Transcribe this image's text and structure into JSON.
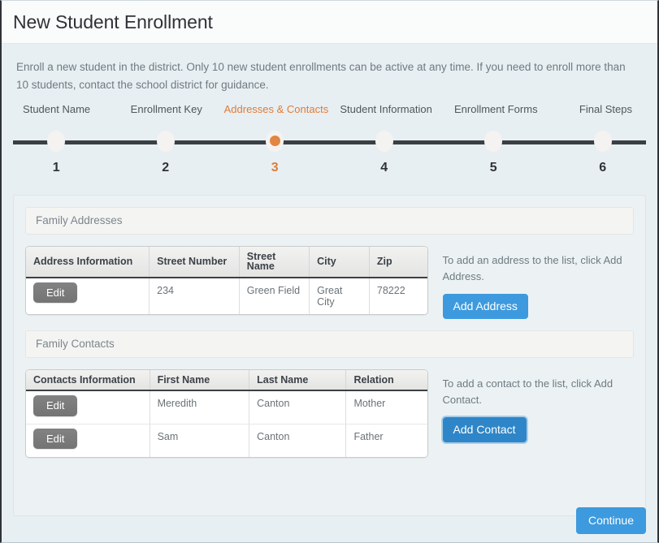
{
  "header": {
    "title": "New Student Enrollment"
  },
  "intro": {
    "text": "Enroll a new student in the district. Only 10 new student enrollments can be active at any time. If you need to enroll more than 10 students, contact the school district for guidance."
  },
  "stepper": {
    "active_step": 3,
    "active_color": "#e07b39",
    "steps": [
      {
        "number": "1",
        "label": "Student Name"
      },
      {
        "number": "2",
        "label": "Enrollment Key"
      },
      {
        "number": "3",
        "label": "Addresses & Contacts"
      },
      {
        "number": "4",
        "label": "Student Information"
      },
      {
        "number": "5",
        "label": "Enrollment Forms"
      },
      {
        "number": "6",
        "label": "Final Steps"
      }
    ]
  },
  "addresses": {
    "section_title": "Family Addresses",
    "columns": [
      "Address Information",
      "Street Number",
      "Street Name",
      "City",
      "Zip"
    ],
    "rows": [
      {
        "edit_label": "Edit",
        "street_number": "234",
        "street_name": "Green Field",
        "city": "Great City",
        "zip": "78222"
      }
    ],
    "helper_text": "To add an address to the list, click Add Address.",
    "add_button_label": "Add Address"
  },
  "contacts": {
    "section_title": "Family Contacts",
    "columns": [
      "Contacts Information",
      "First Name",
      "Last Name",
      "Relation"
    ],
    "rows": [
      {
        "edit_label": "Edit",
        "first_name": "Meredith",
        "last_name": "Canton",
        "relation": "Mother"
      },
      {
        "edit_label": "Edit",
        "first_name": "Sam",
        "last_name": "Canton",
        "relation": "Father"
      }
    ],
    "helper_text": "To add a contact to the list, click Add Contact.",
    "add_button_label": "Add Contact"
  },
  "footer": {
    "continue_label": "Continue"
  },
  "colors": {
    "accent_blue": "#3d9ade",
    "accent_orange": "#e07b39",
    "page_background": "#e8eff2",
    "track": "#3a3f44"
  }
}
